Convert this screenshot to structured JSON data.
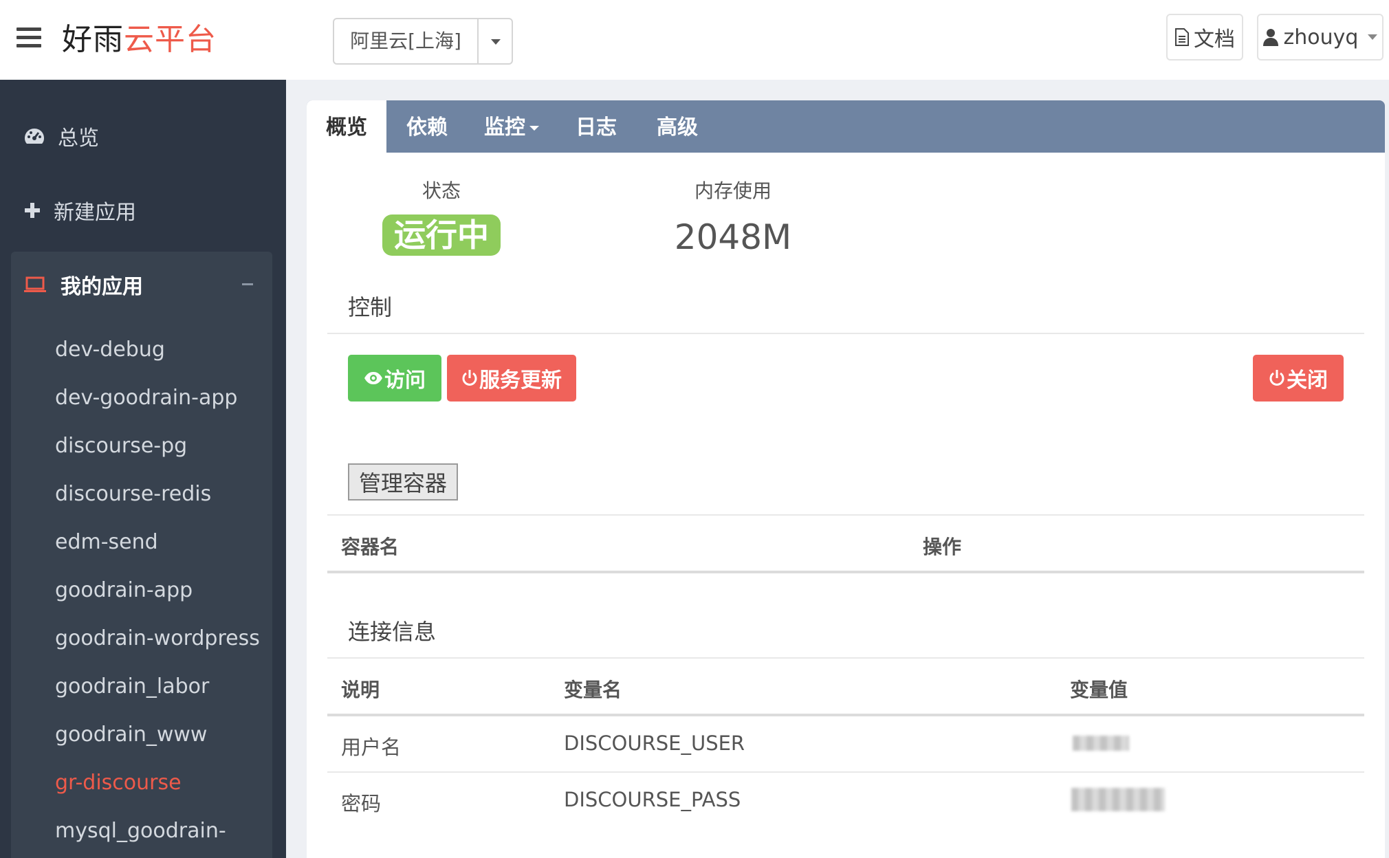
{
  "header": {
    "logo_dark": "好雨",
    "logo_red": "云平台",
    "region": "阿里云[上海]",
    "docs_label": "文档",
    "user_name": "zhouyq"
  },
  "sidebar": {
    "overview": "总览",
    "new_app": "新建应用",
    "my_apps": "我的应用",
    "apps": [
      "dev-debug",
      "dev-goodrain-app",
      "discourse-pg",
      "discourse-redis",
      "edm-send",
      "goodrain-app",
      "goodrain-wordpress",
      "goodrain_labor",
      "goodrain_www",
      "gr-discourse",
      "mysql_goodrain-"
    ],
    "active_app": "gr-discourse"
  },
  "tabs": [
    "概览",
    "依赖",
    "监控",
    "日志",
    "高级"
  ],
  "overview": {
    "status_label": "状态",
    "status_value": "运行中",
    "memory_label": "内存使用",
    "memory_value": "2048M"
  },
  "control": {
    "title": "控制",
    "visit_label": "访问",
    "update_label": "服务更新",
    "close_label": "关闭"
  },
  "containers": {
    "manage_label": "管理容器",
    "col_name": "容器名",
    "col_action": "操作"
  },
  "connection": {
    "title": "连接信息",
    "col_desc": "说明",
    "col_var": "变量名",
    "col_value": "变量值",
    "rows": [
      {
        "desc": "用户名",
        "var": "DISCOURSE_USER"
      },
      {
        "desc": "密码",
        "var": "DISCOURSE_PASS"
      }
    ]
  },
  "colors": {
    "brand_red": "#ee5a4a",
    "sidebar_bg": "#2d3644",
    "tabbar_bg": "#6f84a2",
    "status_green": "#8fcc5c",
    "btn_green": "#5cc55a",
    "btn_red": "#f0625a"
  }
}
